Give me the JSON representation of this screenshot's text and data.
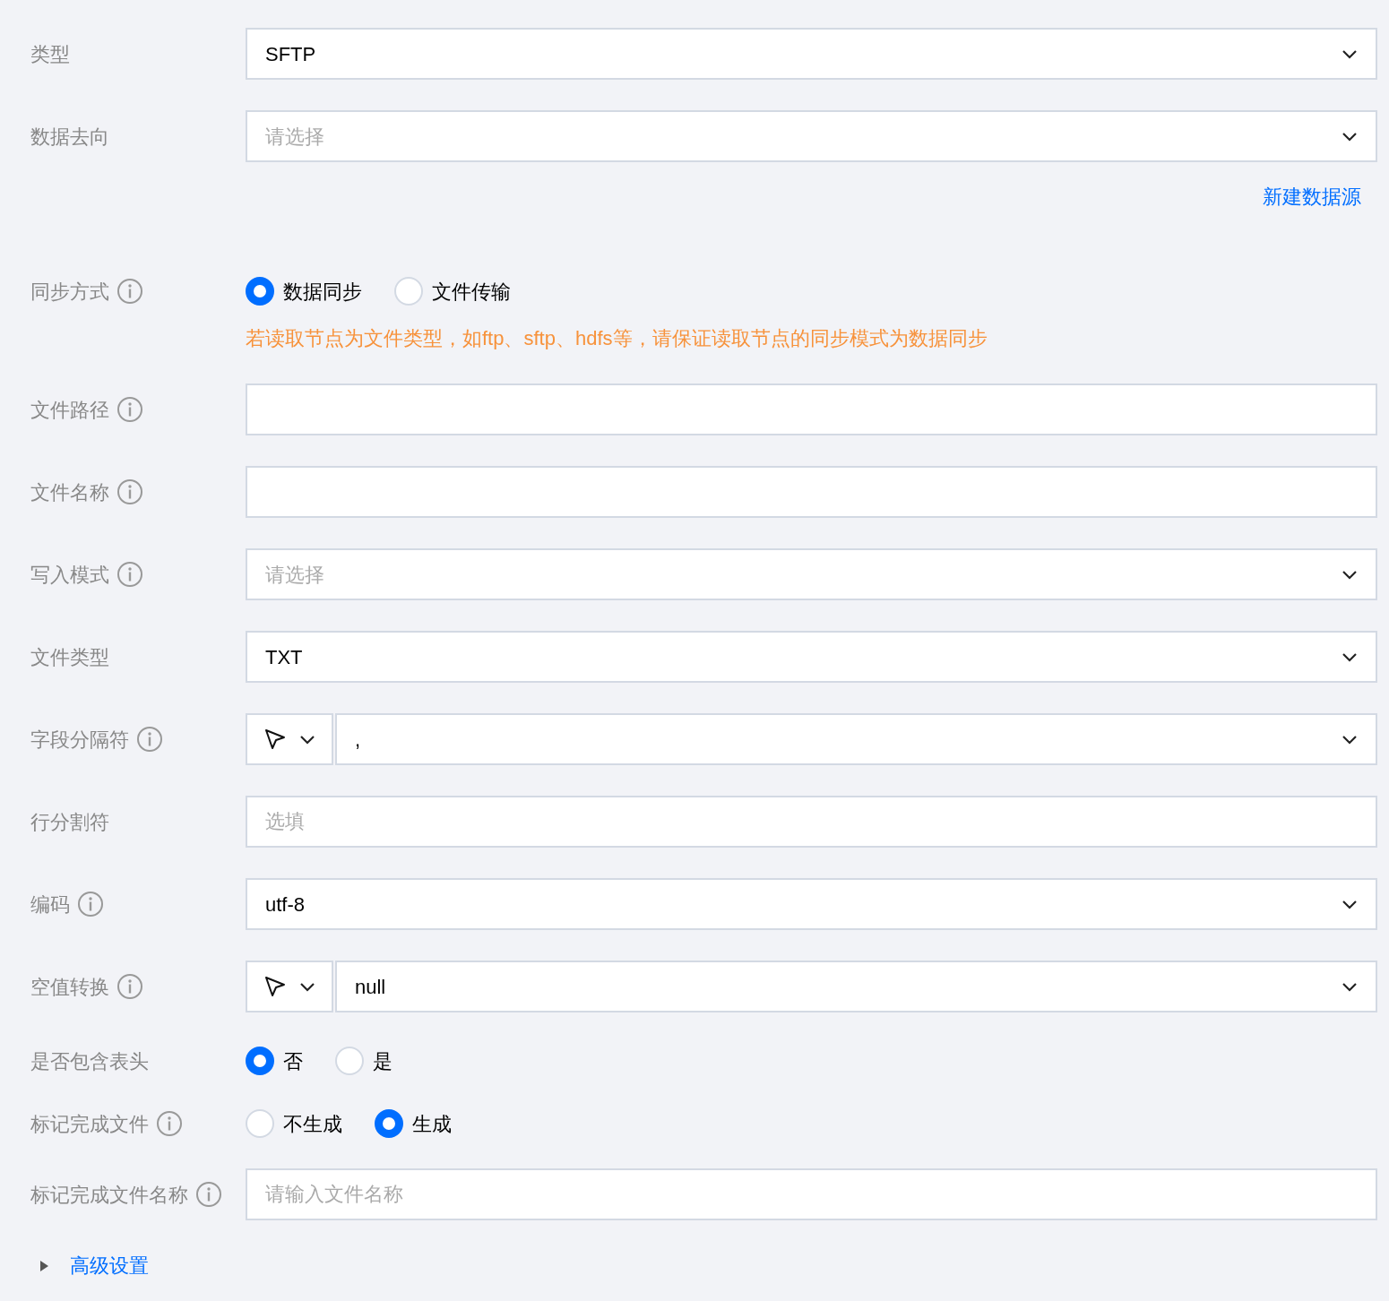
{
  "fields": [
    {
      "label": "类型",
      "info": false,
      "kind": "select",
      "value": "SFTP"
    },
    {
      "label": "数据去向",
      "info": false,
      "kind": "select",
      "placeholder": "请选择",
      "link": "新建数据源"
    },
    {
      "label": "同步方式",
      "info": true,
      "kind": "radio",
      "options": [
        {
          "label": "数据同步",
          "selected": true
        },
        {
          "label": "文件传输",
          "selected": false
        }
      ],
      "hint": "若读取节点为文件类型，如ftp、sftp、hdfs等，请保证读取节点的同步模式为数据同步"
    },
    {
      "label": "文件路径",
      "info": true,
      "kind": "input"
    },
    {
      "label": "文件名称",
      "info": true,
      "kind": "input"
    },
    {
      "label": "写入模式",
      "info": true,
      "kind": "select",
      "placeholder": "请选择"
    },
    {
      "label": "文件类型",
      "info": false,
      "kind": "select",
      "value": "TXT"
    },
    {
      "label": "字段分隔符",
      "info": true,
      "kind": "combo",
      "value": ","
    },
    {
      "label": "行分割符",
      "info": false,
      "kind": "input",
      "placeholder": "选填"
    },
    {
      "label": "编码",
      "info": true,
      "kind": "select",
      "value": "utf-8"
    },
    {
      "label": "空值转换",
      "info": true,
      "kind": "combo",
      "value": "null"
    },
    {
      "label": "是否包含表头",
      "info": false,
      "kind": "radio",
      "options": [
        {
          "label": "否",
          "selected": true
        },
        {
          "label": "是",
          "selected": false
        }
      ]
    },
    {
      "label": "标记完成文件",
      "info": true,
      "kind": "radio",
      "options": [
        {
          "label": "不生成",
          "selected": false
        },
        {
          "label": "生成",
          "selected": true
        }
      ]
    },
    {
      "label": "标记完成文件名称",
      "info": true,
      "kind": "input",
      "placeholder": "请输入文件名称"
    }
  ],
  "advanced": {
    "label": "高级设置",
    "expanded": false
  }
}
